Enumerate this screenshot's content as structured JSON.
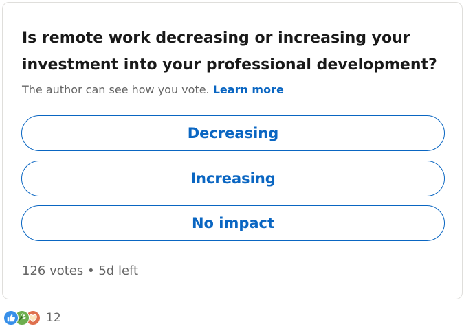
{
  "poll": {
    "question": "Is remote work decreasing or increasing your investment into your professional development?",
    "visibility_note": "The author can see how you vote.",
    "learn_more_label": "Learn more",
    "options": [
      {
        "label": "Decreasing"
      },
      {
        "label": "Increasing"
      },
      {
        "label": "No impact"
      }
    ],
    "votes": "126 votes",
    "separator": "•",
    "time_left": "5d left"
  },
  "reactions": {
    "icons": [
      "like-icon",
      "celebrate-icon",
      "love-icon"
    ],
    "count": "12"
  },
  "colors": {
    "accent": "#0a66c2",
    "muted_text": "#666666",
    "card_border": "#dfdedb",
    "like": "#378fe9",
    "celebrate": "#44712e",
    "love": "#df704d"
  }
}
